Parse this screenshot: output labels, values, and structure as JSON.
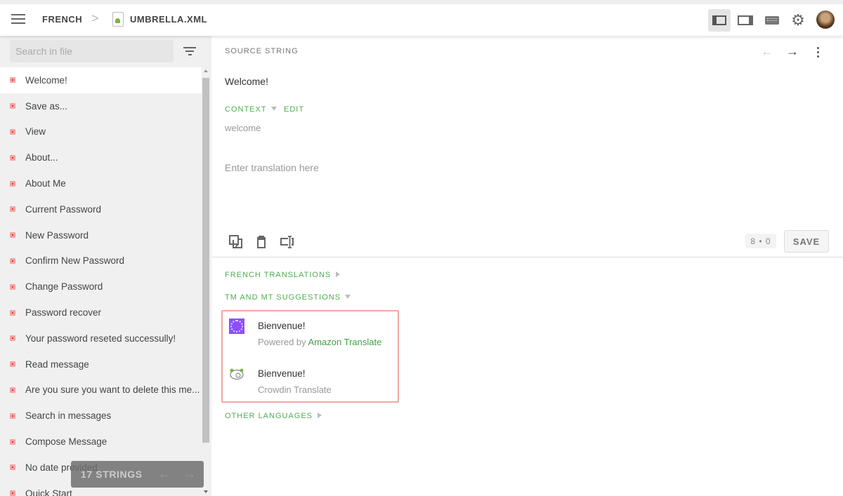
{
  "header": {
    "project": "FRENCH",
    "separator": ">",
    "file_name": "UMBRELLA.XML",
    "icons": [
      "menu-icon",
      "android-file-icon",
      "layout-sidebar-left-icon",
      "layout-sidebar-right-icon",
      "keyboard-icon",
      "settings-icon",
      "avatar"
    ]
  },
  "sidebar": {
    "search_placeholder": "Search in file",
    "strings": [
      "Welcome!",
      "Save as...",
      "View",
      "About...",
      "About Me",
      "Current Password",
      "New Password",
      "Confirm New Password",
      "Change Password",
      "Password recover",
      "Your password reseted successully!",
      "Read message",
      "Are you sure you want to delete this me...",
      "Search in messages",
      "Compose Message",
      "No date provided",
      "Quick Start"
    ],
    "selected_index": 0,
    "counter_label": "17 STRINGS",
    "status_color": "#f2a3a3"
  },
  "main": {
    "source_label": "SOURCE STRING",
    "source_text": "Welcome!",
    "context_label": "CONTEXT",
    "edit_label": "EDIT",
    "context_text": "welcome",
    "translation_placeholder": "Enter translation here",
    "count_badge": "8 • 0",
    "save_label": "SAVE",
    "sections": {
      "french_translations": "FRENCH TRANSLATIONS",
      "tm_mt": "TM AND MT SUGGESTIONS",
      "other_languages": "OTHER LANGUAGES"
    },
    "suggestions": [
      {
        "text": "Bienvenue!",
        "prefix": "Powered by ",
        "source": "Amazon Translate"
      },
      {
        "text": "Bienvenue!",
        "prefix": "",
        "source": "Crowdin Translate"
      }
    ],
    "accent_color": "#4caf50"
  }
}
